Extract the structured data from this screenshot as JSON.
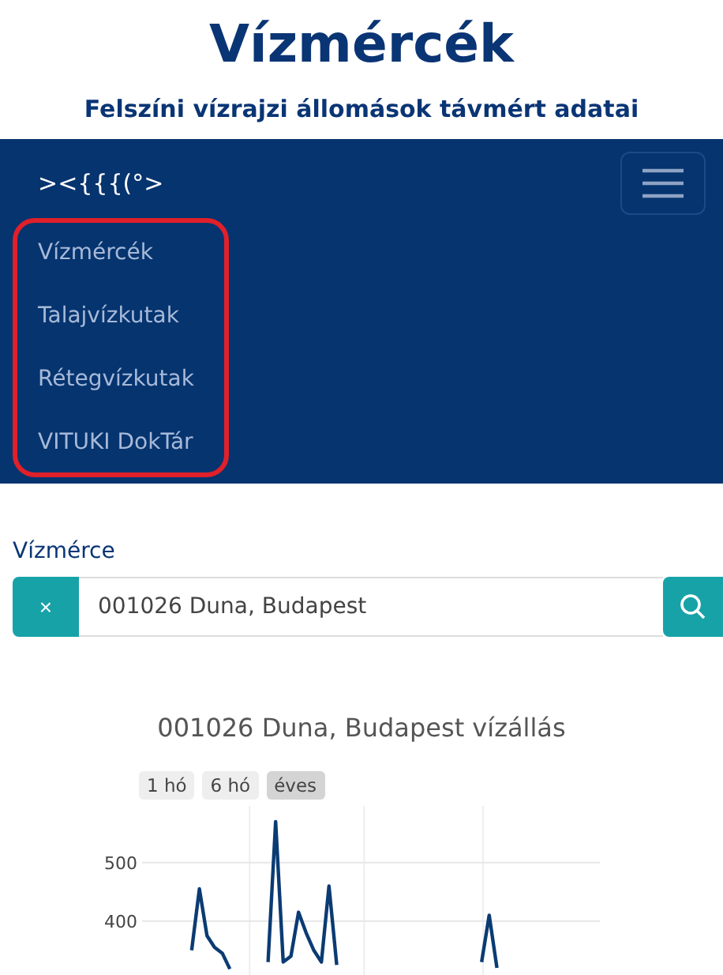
{
  "header": {
    "title": "Vízmércék",
    "subtitle": "Felszíni vízrajzi állomások távmért adatai"
  },
  "navbar": {
    "brand": "><{{{(°>",
    "items": [
      {
        "label": "Vízmércék"
      },
      {
        "label": "Talajvízkutak"
      },
      {
        "label": "Rétegvízkutak"
      },
      {
        "label": "VITUKI DokTár"
      }
    ],
    "highlighted": true
  },
  "station_field": {
    "label": "Vízmérce",
    "clear_button": "×",
    "value": "001026 Duna, Budapest"
  },
  "chart": {
    "range_buttons": [
      {
        "label": "1 hó",
        "selected": false
      },
      {
        "label": "6 hó",
        "selected": false
      },
      {
        "label": "éves",
        "selected": true
      }
    ],
    "chart_data": {
      "type": "line",
      "title": "001026 Duna, Budapest vízállás",
      "ylim": [
        290,
        597
      ],
      "yticks": [
        400,
        500
      ],
      "categories": [
        null,
        null,
        null,
        null,
        null,
        null,
        null,
        null,
        null,
        null,
        null,
        null,
        null,
        null,
        null,
        null,
        null,
        null,
        null,
        null,
        null,
        null,
        null,
        null,
        null,
        null,
        null,
        null,
        null,
        null,
        null,
        null,
        null,
        null,
        null,
        null,
        null,
        null,
        null,
        null,
        null,
        null,
        null,
        null,
        null,
        null,
        null,
        null,
        null,
        null,
        null,
        null,
        null,
        null,
        null,
        null,
        null,
        null,
        null,
        null
      ],
      "series": [
        {
          "color": "#0b3b73",
          "values": [
            null,
            null,
            null,
            null,
            null,
            null,
            350,
            455,
            375,
            355,
            345,
            318,
            null,
            null,
            null,
            null,
            330,
            570,
            330,
            340,
            415,
            380,
            350,
            330,
            460,
            325,
            null,
            null,
            null,
            null,
            null,
            null,
            null,
            null,
            null,
            null,
            null,
            null,
            null,
            null,
            null,
            null,
            null,
            null,
            330,
            410,
            320,
            null,
            null,
            null,
            null,
            null,
            null,
            null,
            null,
            null,
            null,
            null,
            null,
            null
          ]
        }
      ]
    }
  }
}
